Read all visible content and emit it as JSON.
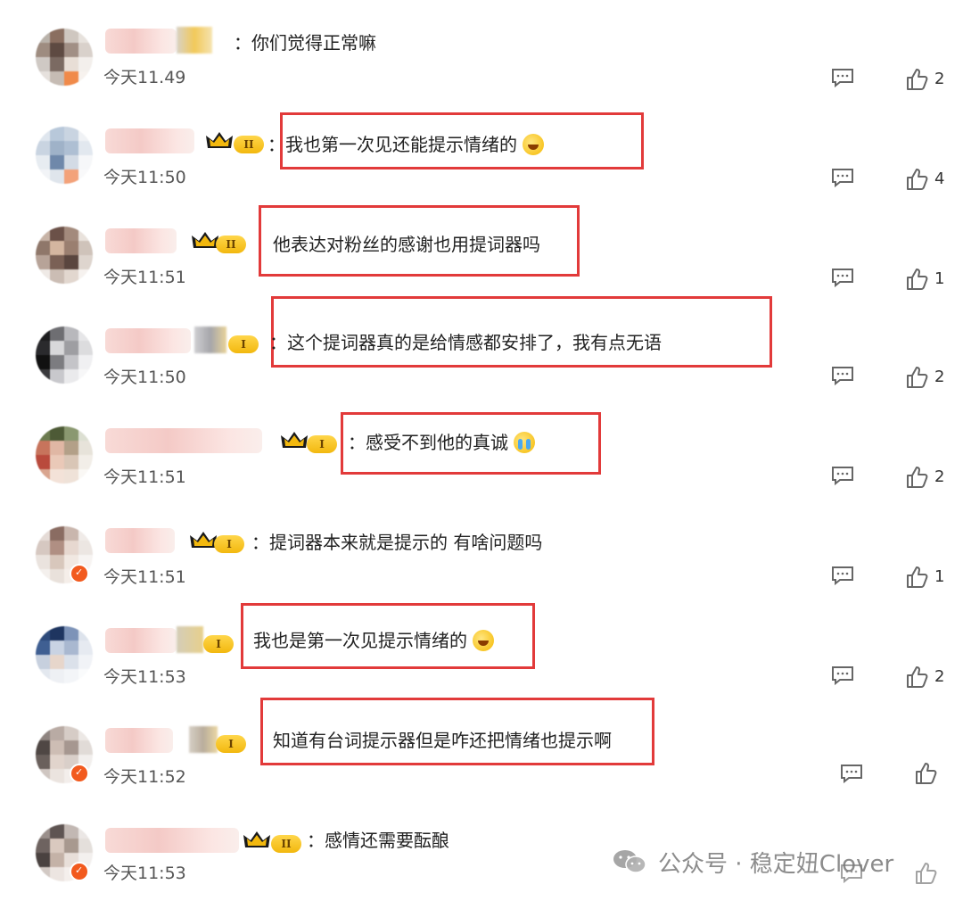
{
  "comments": [
    {
      "text": "你们觉得正常嘛",
      "time": "今天11.49",
      "likes": "2",
      "highlighted": false,
      "emoji": ""
    },
    {
      "text": "我也第一次见还能提示情绪的",
      "time": "今天11:50",
      "likes": "4",
      "highlighted": true,
      "emoji": "laugh"
    },
    {
      "text": "他表达对粉丝的感谢也用提词器吗",
      "time": "今天11:51",
      "likes": "1",
      "highlighted": true,
      "emoji": ""
    },
    {
      "text": "这个提词器真的是给情感都安排了，我有点无语",
      "time": "今天11:50",
      "likes": "2",
      "highlighted": true,
      "emoji": ""
    },
    {
      "text": "感受不到他的真诚",
      "time": "今天11:51",
      "likes": "2",
      "highlighted": true,
      "emoji": "cry"
    },
    {
      "text": "提词器本来就是提示的 有啥问题吗",
      "time": "今天11:51",
      "likes": "1",
      "highlighted": false,
      "emoji": ""
    },
    {
      "text": "我也是第一次见提示情绪的",
      "time": "今天11:53",
      "likes": "2",
      "highlighted": true,
      "emoji": "laugh"
    },
    {
      "text": "知道有台词提示器但是咋还把情绪也提示啊",
      "time": "今天11:52",
      "likes": "",
      "highlighted": true,
      "emoji": ""
    },
    {
      "text": "感情还需要酝酿",
      "time": "今天11:53",
      "likes": "",
      "highlighted": false,
      "emoji": ""
    }
  ],
  "badges": {
    "level_2": "II",
    "level_1": "I",
    "separator": "："
  },
  "watermark": {
    "text": "公众号 · 稳定妞Clover"
  },
  "colors": {
    "highlight_border": "#e23a3a",
    "badge_gold": "#f2b80e",
    "verified_orange": "#f25a1e"
  },
  "icons": {
    "comment": "comment-icon",
    "like": "thumbs-up-icon",
    "wechat": "wechat-icon",
    "crown": "crown-icon"
  }
}
